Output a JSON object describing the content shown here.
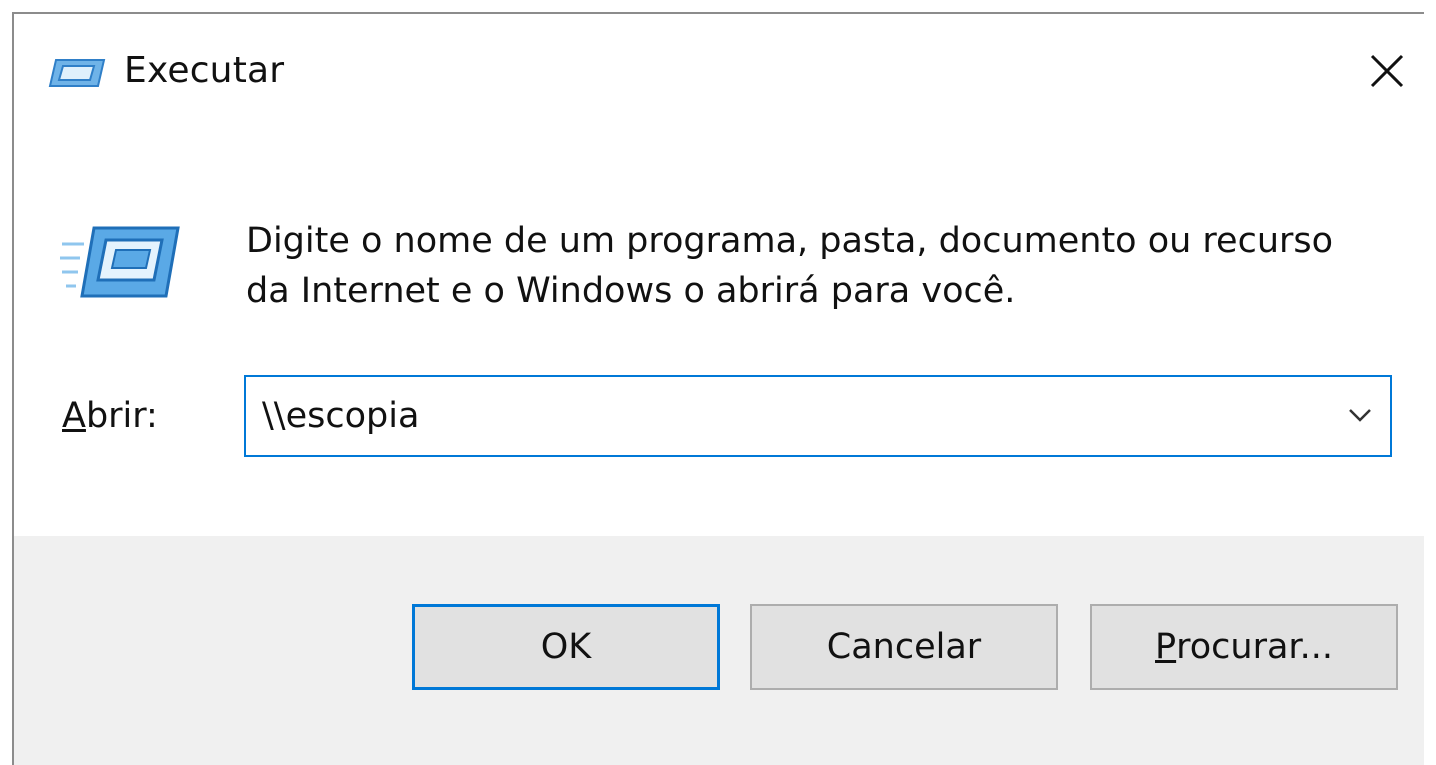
{
  "window": {
    "title": "Executar",
    "icon": "run-icon",
    "close_icon": "close-icon"
  },
  "content": {
    "description": "Digite o nome de um programa, pasta, documento ou recurso da Internet e o Windows o abrirá para você.",
    "open_label_mnemonic": "A",
    "open_label_rest": "brir:",
    "open_value": "\\\\escopia",
    "dropdown_icon": "chevron-down-icon"
  },
  "buttons": {
    "ok_label": "OK",
    "cancel_label": "Cancelar",
    "browse_mnemonic": "P",
    "browse_rest": "rocurar..."
  },
  "colors": {
    "accent": "#0078d7",
    "footer_bg": "#f0f0f0",
    "button_bg": "#e1e1e1"
  }
}
